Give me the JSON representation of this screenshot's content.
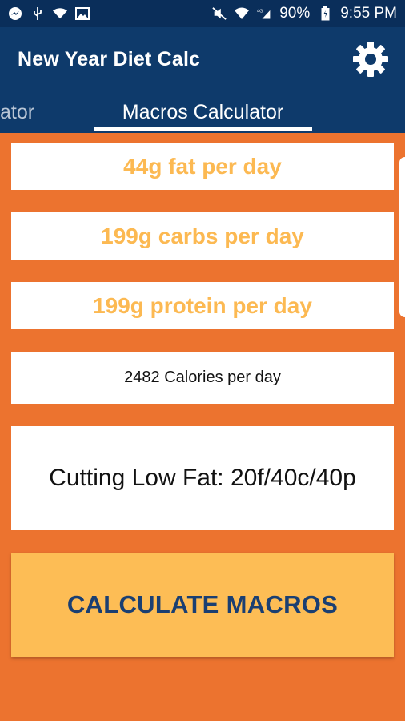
{
  "status_bar": {
    "battery": "90%",
    "time": "9:55 PM",
    "network": "4G",
    "icons": [
      "messenger-icon",
      "usb-icon",
      "wifi-icon",
      "image-icon",
      "mute-icon",
      "wifi-calling-icon",
      "signal-icon",
      "battery-icon"
    ]
  },
  "app_bar": {
    "title": "New Year Diet Calc",
    "settings_icon": "gear-icon"
  },
  "tabs": {
    "prev_partial": "ator",
    "active": "Macros Calculator"
  },
  "results": {
    "fat": "44g fat per day",
    "carbs": "199g carbs per day",
    "protein": "199g protein per day",
    "calories": "2482 Calories per day",
    "plan": "Cutting Low Fat: 20f/40c/40p"
  },
  "actions": {
    "calculate": "CALCULATE MACROS"
  },
  "colors": {
    "status_bar": "#0a2e5a",
    "app_bar": "#0e3a6b",
    "background": "#ec732f",
    "macro_text": "#fcb952",
    "button": "#fdbd55",
    "button_text": "#1a3f72"
  }
}
